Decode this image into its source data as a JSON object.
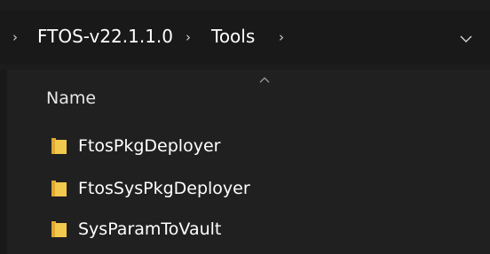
{
  "breadcrumb": {
    "items": [
      "FTOS-v22.1.1.0",
      "Tools"
    ],
    "separator_icon": "chevron-right-icon",
    "dropdown_icon": "chevron-down-icon"
  },
  "file_list": {
    "column_header": "Name",
    "sort_indicator": "sort-ascending-icon",
    "folder_color": "#f2c94c",
    "items": [
      {
        "name": "FtosPkgDeployer",
        "type": "folder"
      },
      {
        "name": "FtosSysPkgDeployer",
        "type": "folder"
      },
      {
        "name": "SysParamToVault",
        "type": "folder"
      }
    ]
  }
}
